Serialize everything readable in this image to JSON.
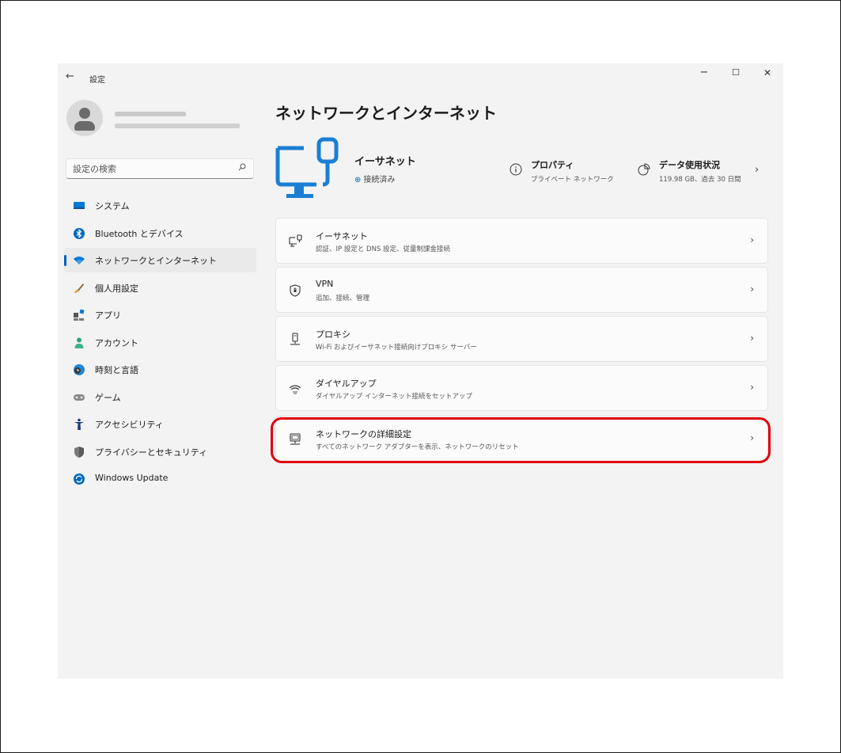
{
  "titlebar": {
    "back_icon": "←",
    "title": "設定",
    "minimize": "−",
    "maximize": "☐",
    "close": "✕"
  },
  "sidebar": {
    "search_placeholder": "設定の検索",
    "search_icon": "⚲",
    "items": [
      {
        "label": "システム",
        "icon": "monitor-icon"
      },
      {
        "label": "Bluetooth とデバイス",
        "icon": "bluetooth-icon"
      },
      {
        "label": "ネットワークとインターネット",
        "icon": "wifi-icon",
        "selected": true
      },
      {
        "label": "個人用設定",
        "icon": "brush-icon"
      },
      {
        "label": "アプリ",
        "icon": "apps-icon"
      },
      {
        "label": "アカウント",
        "icon": "person-icon"
      },
      {
        "label": "時刻と言語",
        "icon": "clock-globe-icon"
      },
      {
        "label": "ゲーム",
        "icon": "gamepad-icon"
      },
      {
        "label": "アクセシビリティ",
        "icon": "accessibility-icon"
      },
      {
        "label": "プライバシーとセキュリティ",
        "icon": "shield-icon"
      },
      {
        "label": "Windows Update",
        "icon": "update-icon"
      }
    ]
  },
  "main": {
    "page_title": "ネットワークとインターネット",
    "hero": {
      "title": "イーサネット",
      "status": "接続済み"
    },
    "properties": {
      "title": "プロパティ",
      "subtitle": "プライベート ネットワーク"
    },
    "data_usage": {
      "title": "データ使用状況",
      "subtitle": "119.98 GB、過去 30 日間"
    },
    "chevron": "›",
    "cards": [
      {
        "title": "イーサネット",
        "subtitle": "認証、IP 設定と DNS 設定、従量制課金接続",
        "icon": "ethernet-icon"
      },
      {
        "title": "VPN",
        "subtitle": "追加、接続、管理",
        "icon": "vpn-shield-icon"
      },
      {
        "title": "プロキシ",
        "subtitle": "Wi-Fi およびイーサネット接続向けプロキシ サーバー",
        "icon": "proxy-icon"
      },
      {
        "title": "ダイヤルアップ",
        "subtitle": "ダイヤルアップ インターネット接続をセットアップ",
        "icon": "dialup-icon"
      },
      {
        "title": "ネットワークの詳細設定",
        "subtitle": "すべてのネットワーク アダプターを表示、ネットワークのリセット",
        "icon": "advanced-network-icon"
      }
    ]
  },
  "colors": {
    "accent": "#005fb8",
    "highlight": "#e0000b"
  }
}
